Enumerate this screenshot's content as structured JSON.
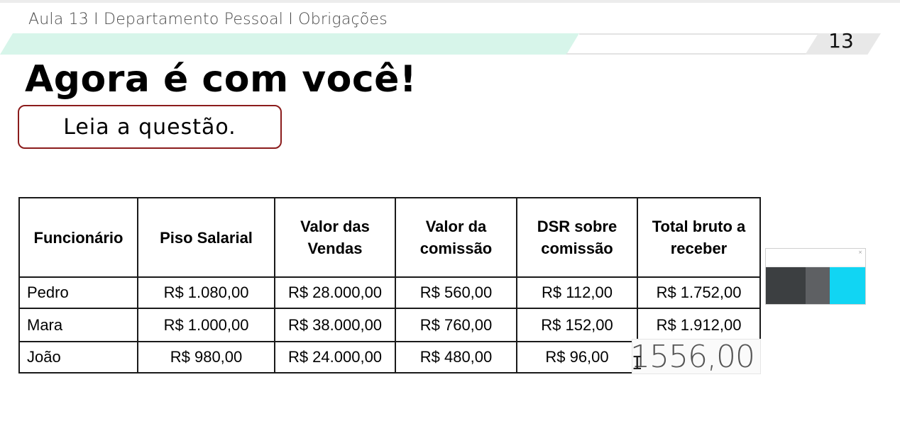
{
  "header": {
    "breadcrumb": "Aula 13 I Departamento Pessoal I Obrigações",
    "page_number": "13",
    "band_color": "#d7f5ea"
  },
  "slide": {
    "title": "Agora é com você!",
    "instruction": "Leia a questão.",
    "instruction_border_color": "#8b1c1c"
  },
  "table": {
    "headers": [
      "Funcionário",
      "Piso Salarial",
      "Valor das Vendas",
      "Valor da comissão",
      "DSR sobre comissão",
      "Total bruto a receber"
    ],
    "rows": [
      [
        "Pedro",
        "R$ 1.080,00",
        "R$ 28.000,00",
        "R$ 560,00",
        "R$ 112,00",
        "R$ 1.752,00"
      ],
      [
        "Mara",
        "R$ 1.000,00",
        "R$ 38.000,00",
        "R$ 760,00",
        "R$ 152,00",
        "R$ 1.912,00"
      ],
      [
        "João",
        "R$ 980,00",
        "R$ 24.000,00",
        "R$ 480,00",
        "R$ 96,00",
        ""
      ]
    ]
  },
  "entry": {
    "value": "1556,00",
    "cursor_icon": "text-cursor-icon"
  },
  "calculator": {
    "icon": "calculator-window-icon",
    "accent_color": "#11d5f3"
  }
}
